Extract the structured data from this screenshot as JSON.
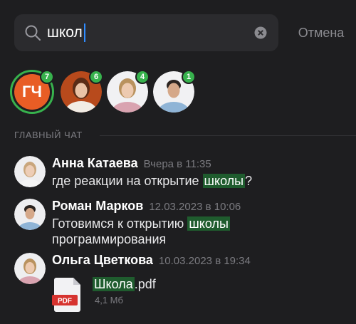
{
  "search": {
    "query": "школ",
    "cancel_label": "Отмена"
  },
  "contacts": [
    {
      "initials": "ГЧ",
      "badge": "7",
      "avatar_color": "#e85d25"
    },
    {
      "badge": "6"
    },
    {
      "badge": "4"
    },
    {
      "badge": "1"
    }
  ],
  "section": {
    "title": "ГЛАВНЫЙ ЧАТ"
  },
  "messages": [
    {
      "author": "Анна Катаева",
      "time": "Вчера в 11:35",
      "text_before": "где реакции на открытие ",
      "text_match": "школы",
      "text_after": "?"
    },
    {
      "author": "Роман Марков",
      "time": "12.03.2023 в 10:06",
      "text_before": "Готовимся к открытию ",
      "text_match": "школы",
      "text_after": " программирования"
    },
    {
      "author": "Ольга Цветкова",
      "time": "10.03.2023 в 19:34",
      "file_match": "Школа",
      "file_rest": ".pdf",
      "file_size": "4,1 Мб",
      "file_type": "PDF"
    }
  ],
  "colors": {
    "background": "#1e1e20",
    "badge": "#37b24d",
    "highlight": "#1f5c2e",
    "caret": "#2f8cff"
  }
}
